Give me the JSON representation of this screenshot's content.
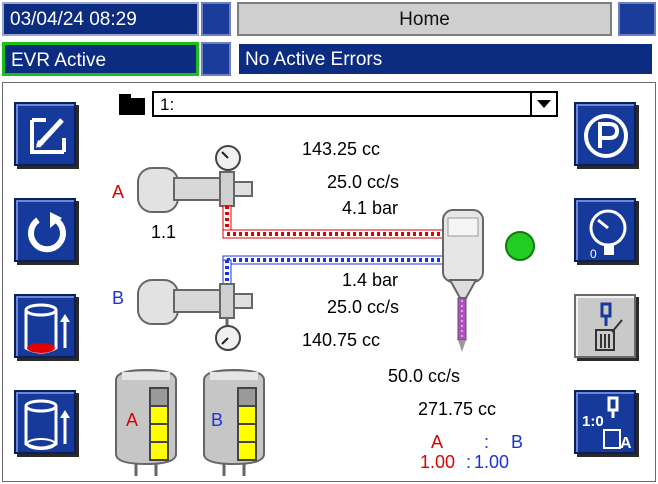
{
  "header": {
    "datetime": "03/04/24 08:29",
    "screen_title": "Home",
    "status": "EVR Active",
    "errors": "No Active Errors"
  },
  "recipe": {
    "selected": "1:"
  },
  "side_a": {
    "label": "A",
    "ratio_value": "1.1",
    "volume": "143.25 cc",
    "flow": "25.0 cc/s",
    "pressure": "4.1 bar"
  },
  "side_b": {
    "label": "B",
    "volume": "140.75 cc",
    "flow": "25.0 cc/s",
    "pressure": "1.4 bar"
  },
  "mix": {
    "flow": "50.0  cc/s",
    "volume": "271.75  cc",
    "ratio_label_a": "A",
    "ratio_sep": ":",
    "ratio_label_b": "B",
    "ratio_a": "1.00",
    "ratio_b": "1.00",
    "status_color": "#22cc22"
  },
  "tanks": {
    "tank_a_label": "A",
    "tank_b_label": "B"
  },
  "colors": {
    "accent": "#163a9c",
    "side_a": "#e00000",
    "side_b": "#1a33dd"
  }
}
